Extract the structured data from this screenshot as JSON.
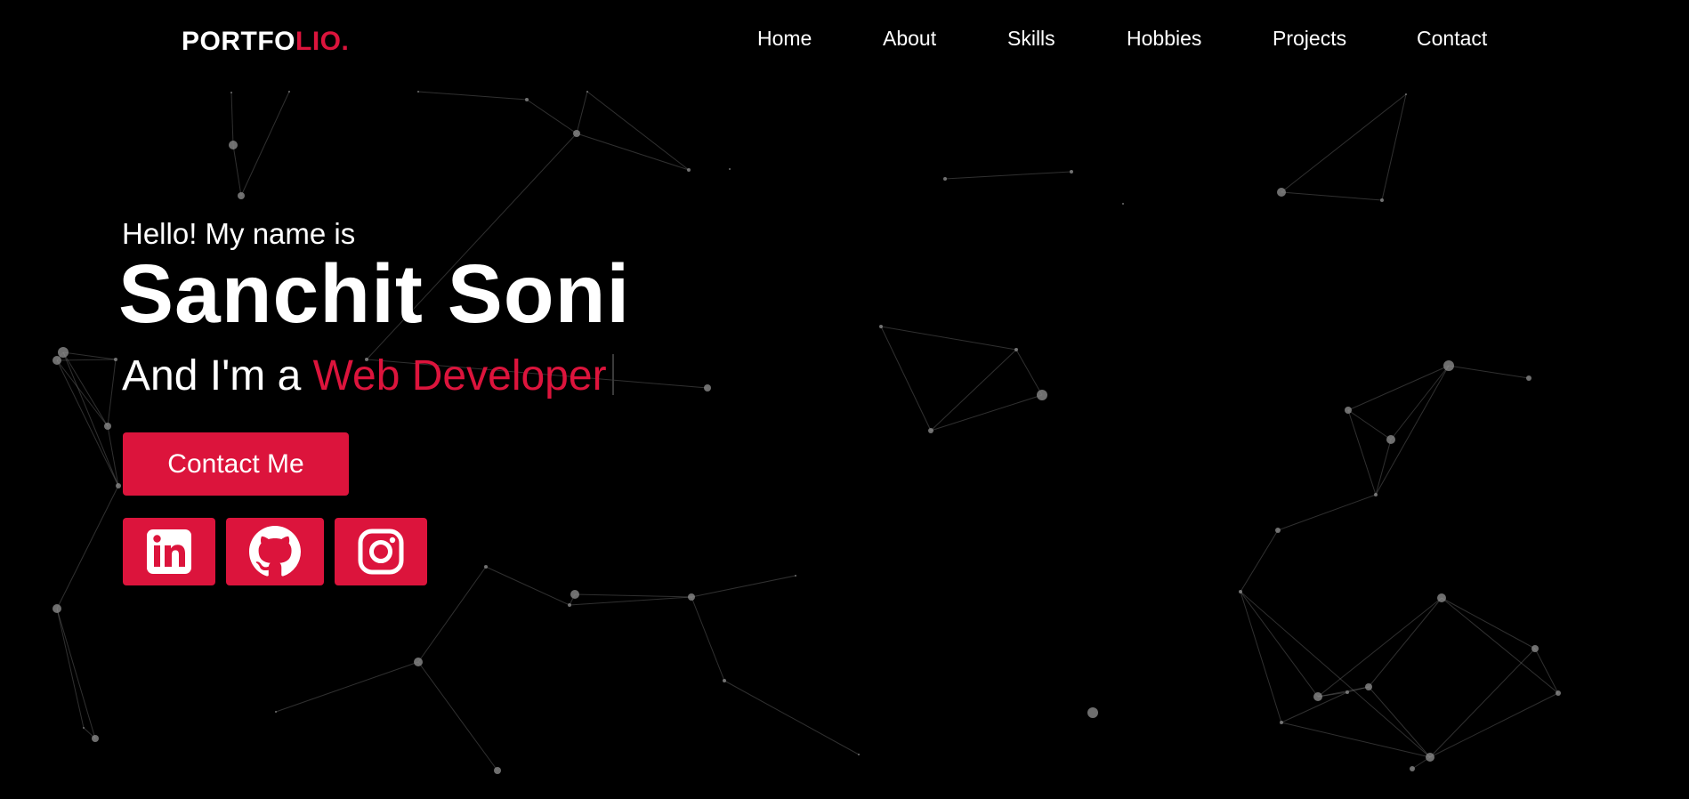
{
  "brand": {
    "prefix": "PORTFO",
    "accent": "LIO."
  },
  "nav": {
    "items": [
      "Home",
      "About",
      "Skills",
      "Hobbies",
      "Projects",
      "Contact"
    ]
  },
  "hero": {
    "greeting": "Hello! My name is",
    "name": "Sanchit Soni",
    "role_prefix": "And I'm a ",
    "role_typed": "Web Developer",
    "contact_label": "Contact Me"
  },
  "social": [
    "linkedin-icon",
    "github-icon",
    "instagram-icon"
  ],
  "colors": {
    "background": "#000000",
    "accent": "#dc143c",
    "text": "#ffffff",
    "particles": "#8a8a8a"
  }
}
